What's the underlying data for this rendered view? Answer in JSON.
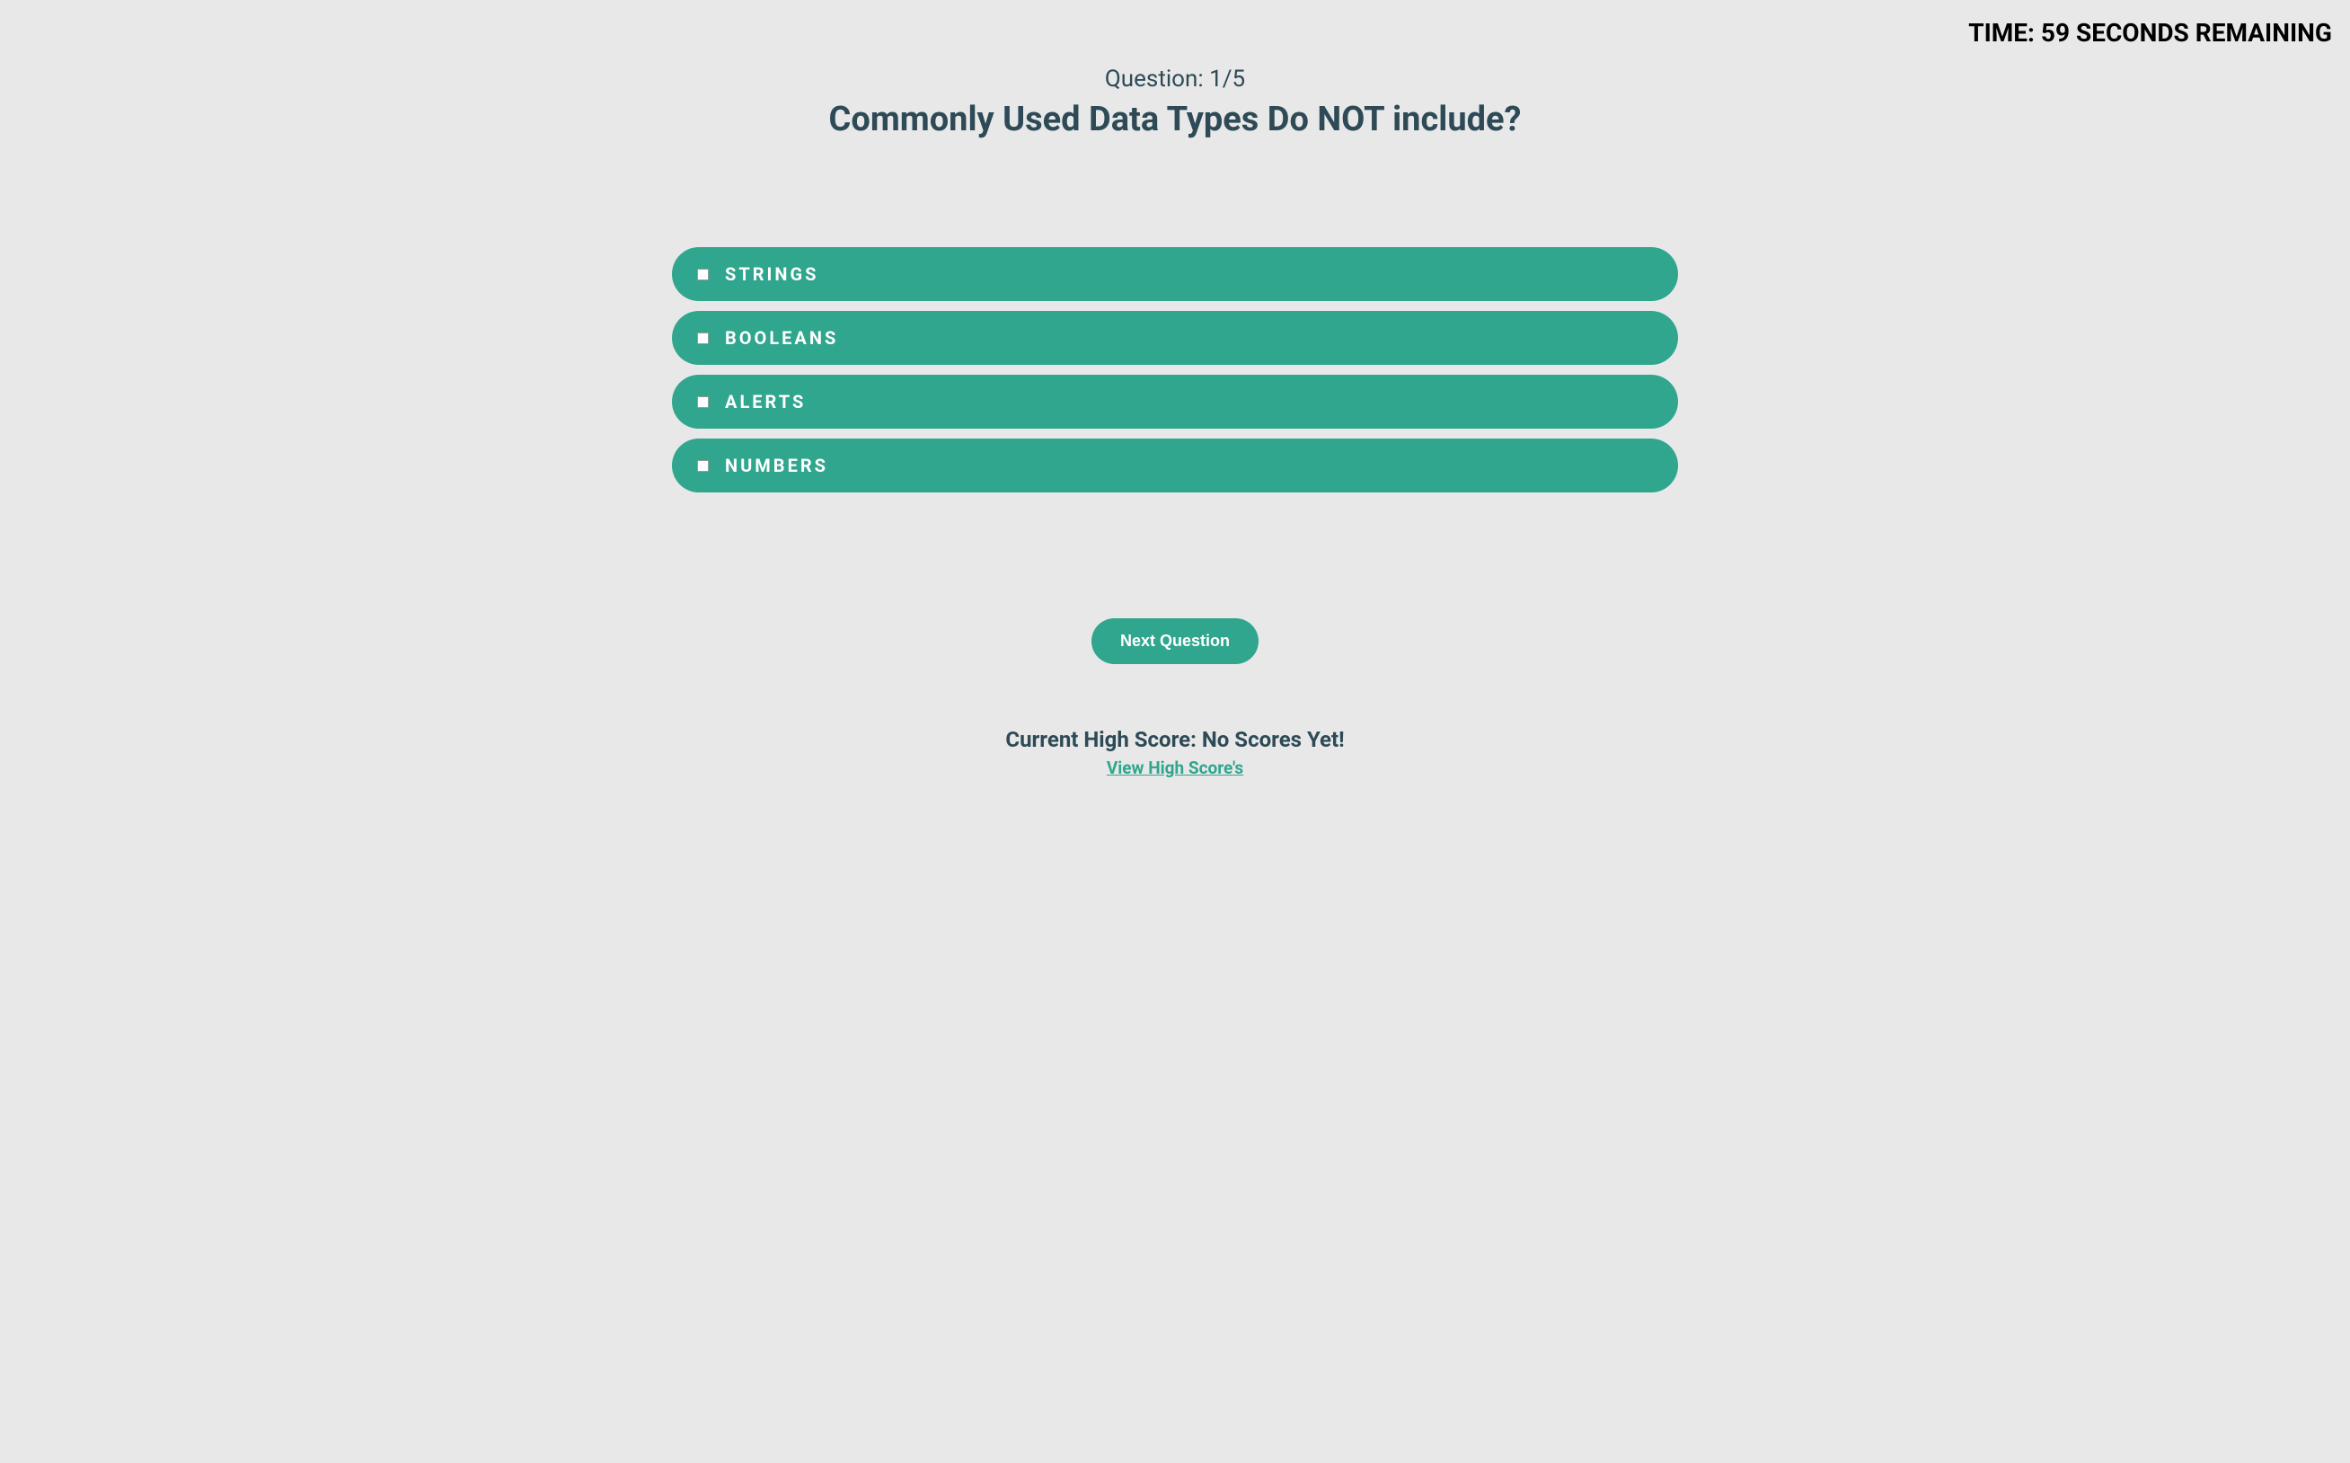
{
  "timer": {
    "text": "TIME: 59 SECONDS REMAINING"
  },
  "question": {
    "number_label": "Question: 1/5",
    "text": "Commonly Used Data Types Do NOT include?"
  },
  "answers": [
    {
      "label": "STRINGS"
    },
    {
      "label": "BOOLEANS"
    },
    {
      "label": "ALERTS"
    },
    {
      "label": "NUMBERS"
    }
  ],
  "next_button": {
    "label": "Next Question"
  },
  "footer": {
    "high_score_text": "Current High Score: No Scores Yet!",
    "view_link": "View High Score's"
  }
}
